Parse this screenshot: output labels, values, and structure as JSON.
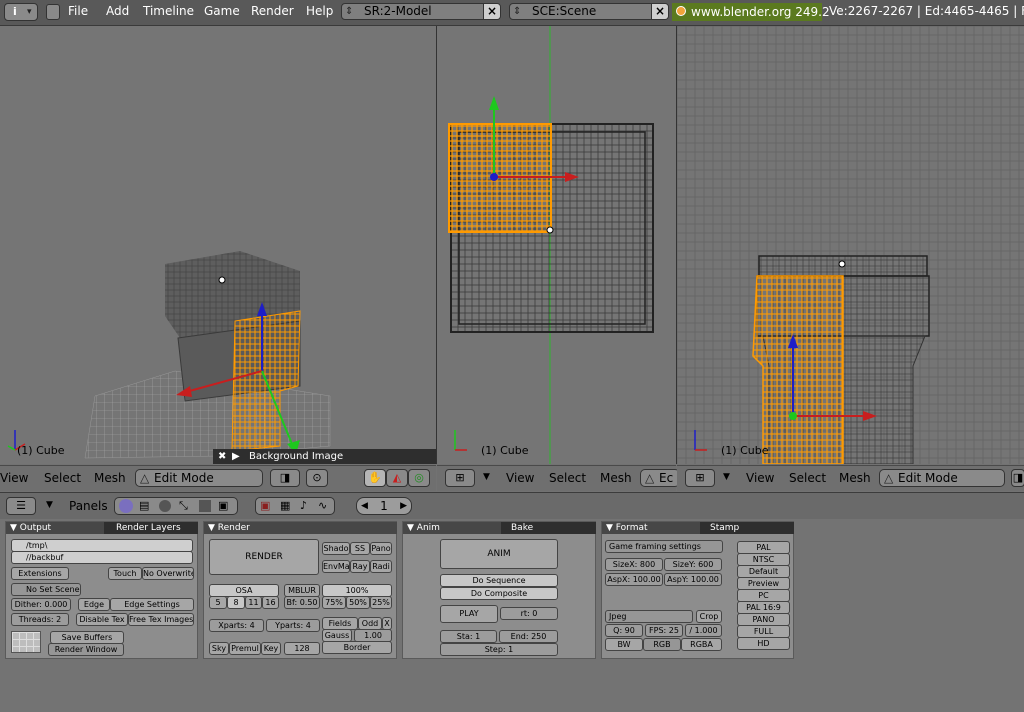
{
  "topbar": {
    "menus": [
      "File",
      "Add",
      "Timeline",
      "Game",
      "Render",
      "Help"
    ],
    "screen": "SR:2-Model",
    "scene": "SCE:Scene",
    "url": "www.blender.org 249.2",
    "stats": "Ve:2267-2267 | Ed:4465-4465 | F"
  },
  "viewports": {
    "left": {
      "object_label": "(1) Cube",
      "bg_image_label": "Background Image"
    },
    "middle": {
      "object_label": "(1) Cube"
    },
    "right": {
      "object_label": "(1) Cube"
    }
  },
  "view_headers": {
    "view": "View",
    "select": "Select",
    "mesh": "Mesh",
    "mode": "Edit Mode",
    "mode_short": "Ec"
  },
  "buttons_header": {
    "panels_label": "Panels",
    "frame": "1"
  },
  "output_panel": {
    "tab_output": "Output",
    "tab_render_layers": "Render Layers",
    "path1": "/tmp\\",
    "path2": "//backbuf",
    "extensions": "Extensions",
    "touch": "Touch",
    "no_overwrite": "No Overwrite",
    "no_set_scene": "No Set Scene",
    "dither": "Dither: 0.000",
    "edge": "Edge",
    "edge_settings": "Edge Settings",
    "threads": "Threads: 2",
    "disable_tex": "Disable Tex",
    "free_tex": "Free Tex Images",
    "save_buffers": "Save Buffers",
    "render_window": "Render Window"
  },
  "render_panel": {
    "tab": "Render",
    "render": "RENDER",
    "shado": "Shado",
    "ss": "SS",
    "pano": "Pano",
    "envma": "EnvMa",
    "ray": "Ray",
    "radi": "Radi",
    "osa": "OSA",
    "mblur": "MBLUR",
    "bf": "Bf: 0.50",
    "osa_levels": [
      "5",
      "8",
      "11",
      "16"
    ],
    "percent": "100%",
    "p75": "75%",
    "p50": "50%",
    "p25": "25%",
    "xparts": "Xparts: 4",
    "yparts": "Yparts: 4",
    "fields": "Fields",
    "odd": "Odd",
    "x": "X",
    "gauss": "Gauss",
    "gauss_val": "1.00",
    "sky": "Sky",
    "premul": "Premul",
    "key": "Key",
    "bits": "128",
    "border": "Border"
  },
  "anim_panel": {
    "tab_anim": "Anim",
    "tab_bake": "Bake",
    "anim": "ANIM",
    "do_sequence": "Do Sequence",
    "do_composite": "Do Composite",
    "play": "PLAY",
    "rt": "rt: 0",
    "sta": "Sta: 1",
    "end": "End: 250",
    "step": "Step: 1"
  },
  "format_panel": {
    "tab_format": "Format",
    "tab_stamp": "Stamp",
    "preset": "Game framing settings",
    "sizex": "SizeX: 800",
    "sizey": "SizeY: 600",
    "aspx": "AspX: 100.00",
    "aspy": "AspY: 100.00",
    "codec": "Jpeg",
    "crop": "Crop",
    "quality": "Q: 90",
    "fps": "FPS: 25",
    "fps_div": "/ 1.000",
    "bw": "BW",
    "rgb": "RGB",
    "rgba": "RGBA",
    "presets": [
      "PAL",
      "NTSC",
      "Default",
      "Preview",
      "PC",
      "PAL 16:9",
      "PANO",
      "FULL",
      "HD"
    ]
  }
}
